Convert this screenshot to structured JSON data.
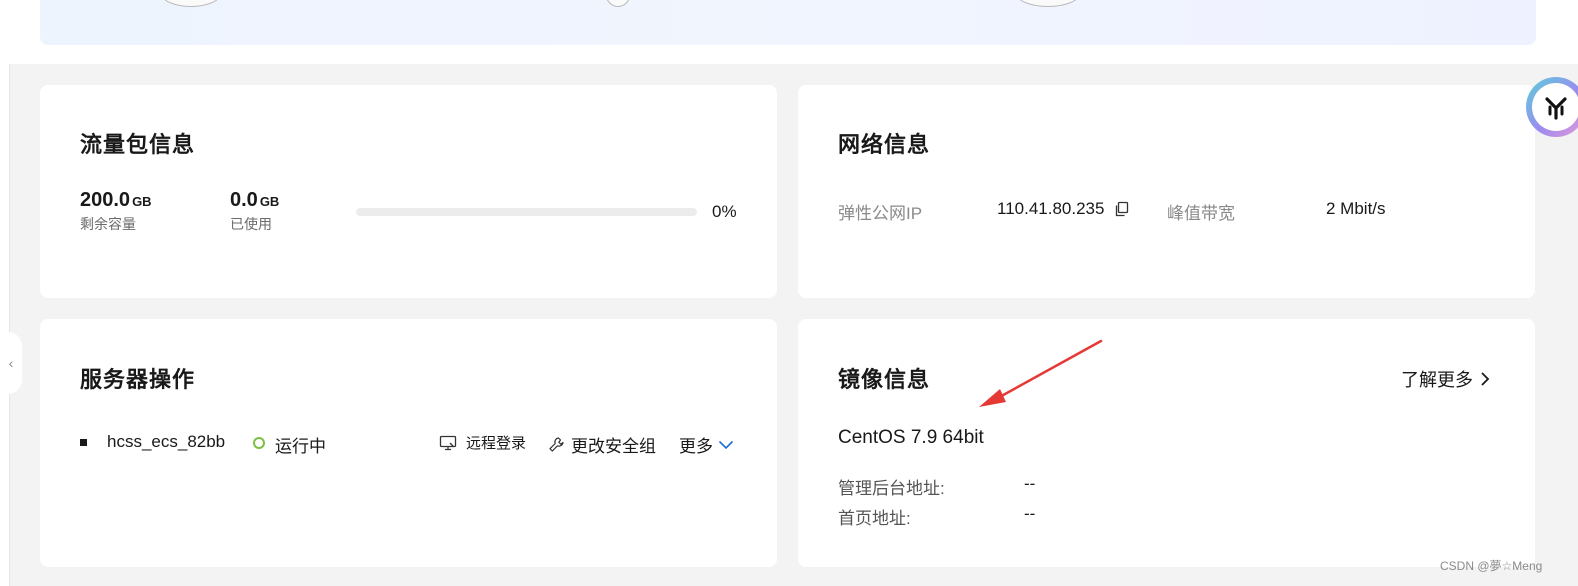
{
  "traffic": {
    "title": "流量包信息",
    "remaining_value": "200.0",
    "remaining_unit": "GB",
    "remaining_label": "剩余容量",
    "used_value": "0.0",
    "used_unit": "GB",
    "used_label": "已使用",
    "usage_percent_text": "0%",
    "usage_fraction": 0
  },
  "network": {
    "title": "网络信息",
    "ip_label": "弹性公网IP",
    "ip_value": "110.41.80.235",
    "bandwidth_label": "峰值带宽",
    "bandwidth_value": "2 Mbit/s"
  },
  "server_ops": {
    "title": "服务器操作",
    "server_name": "hcss_ecs_82bb",
    "status_text": "运行中",
    "status_color": "#7ac143",
    "remote_login_label": "远程登录",
    "change_sg_label": "更改安全组",
    "more_label": "更多"
  },
  "image_info": {
    "title": "镜像信息",
    "learn_more_label": "了解更多",
    "os_name": "CentOS 7.9 64bit",
    "admin_addr_label": "管理后台地址:",
    "admin_addr_value": "--",
    "home_addr_label": "首页地址:",
    "home_addr_value": "--"
  },
  "colors": {
    "accent_blue": "#1d6fd8",
    "annotation_red": "#e53935"
  },
  "watermark": "CSDN @夢☆Meng"
}
